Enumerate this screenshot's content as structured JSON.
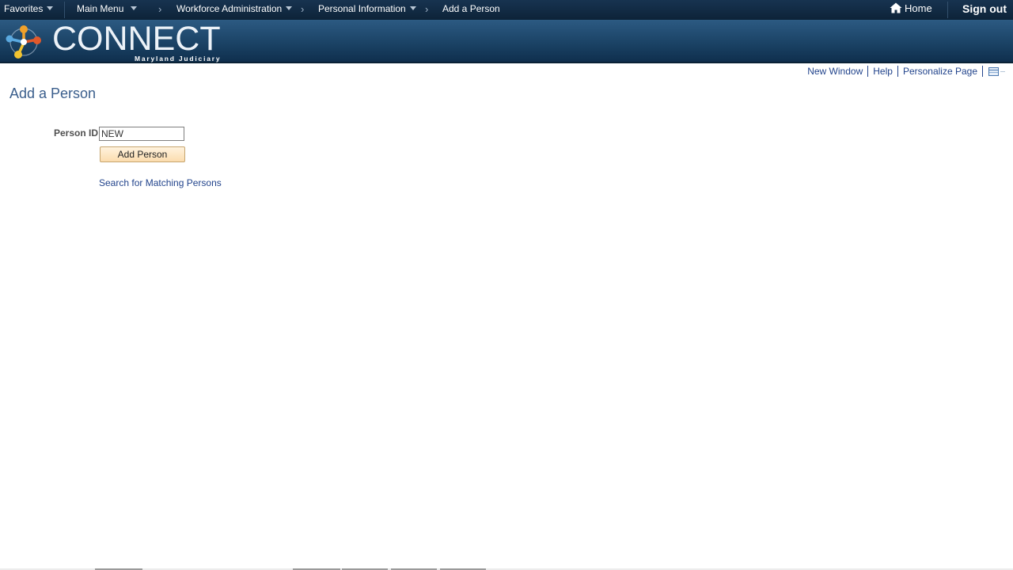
{
  "navbar": {
    "favorites": "Favorites",
    "main_menu": "Main Menu",
    "crumb_sep": "›",
    "breadcrumbs": [
      {
        "label": "Workforce Administration"
      },
      {
        "label": "Personal Information"
      },
      {
        "label": "Add a Person"
      }
    ],
    "home": "Home",
    "sign_out": "Sign out"
  },
  "banner": {
    "logo_title": "CONNECT",
    "logo_subtitle": "Maryland Judiciary"
  },
  "page_links": {
    "new_window": "New Window",
    "help": "Help",
    "personalize": "Personalize Page"
  },
  "page": {
    "title": "Add a Person",
    "person_id_label": "Person ID",
    "person_id_value": "NEW",
    "add_button": "Add Person",
    "search_link": "Search for Matching Persons"
  },
  "colors": {
    "nav_bg": "#0d2338",
    "banner_bg": "#1b4366",
    "link": "#22448c",
    "title": "#3a5e8c",
    "button_bg": "#fbdcae"
  }
}
